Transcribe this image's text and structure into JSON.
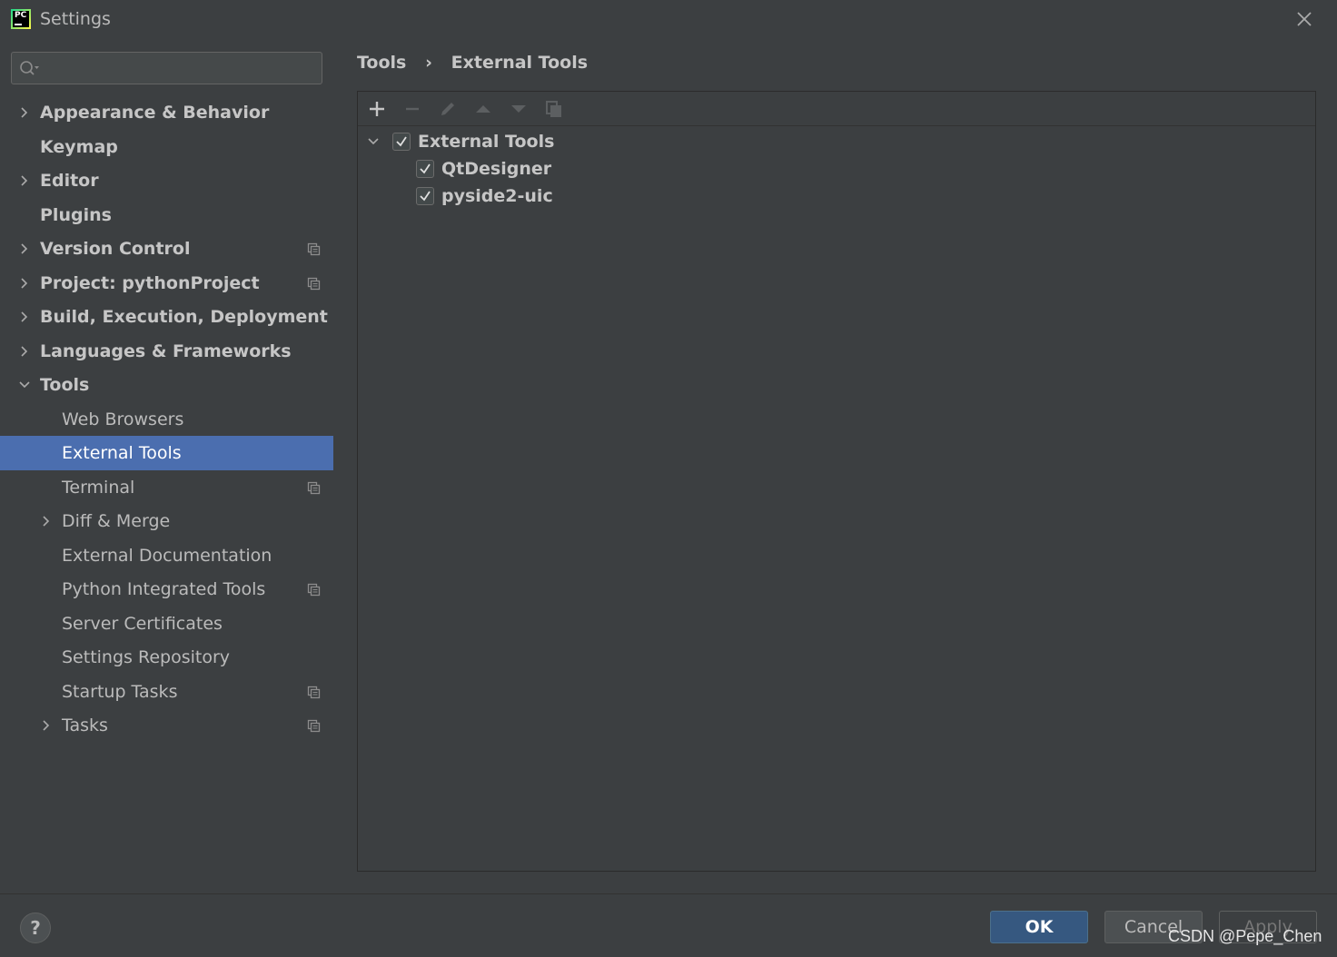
{
  "window": {
    "title": "Settings",
    "logo_text": "PC"
  },
  "search": {
    "value": "",
    "placeholder": ""
  },
  "sidebar": {
    "items": [
      {
        "label": "Appearance & Behavior",
        "expandable": true,
        "expanded": false,
        "bold": true,
        "project_icon": false
      },
      {
        "label": "Keymap",
        "expandable": false,
        "bold": true,
        "project_icon": false
      },
      {
        "label": "Editor",
        "expandable": true,
        "expanded": false,
        "bold": true,
        "project_icon": false
      },
      {
        "label": "Plugins",
        "expandable": false,
        "bold": true,
        "project_icon": false
      },
      {
        "label": "Version Control",
        "expandable": true,
        "expanded": false,
        "bold": true,
        "project_icon": true
      },
      {
        "label": "Project: pythonProject",
        "expandable": true,
        "expanded": false,
        "bold": true,
        "project_icon": true
      },
      {
        "label": "Build, Execution, Deployment",
        "expandable": true,
        "expanded": false,
        "bold": true,
        "project_icon": false
      },
      {
        "label": "Languages & Frameworks",
        "expandable": true,
        "expanded": false,
        "bold": true,
        "project_icon": false
      },
      {
        "label": "Tools",
        "expandable": true,
        "expanded": true,
        "bold": true,
        "project_icon": false
      },
      {
        "label": "Web Browsers",
        "expandable": false,
        "bold": false,
        "project_icon": false
      },
      {
        "label": "External Tools",
        "expandable": false,
        "bold": false,
        "selected": true,
        "project_icon": false
      },
      {
        "label": "Terminal",
        "expandable": false,
        "bold": false,
        "project_icon": true
      },
      {
        "label": "Diff & Merge",
        "expandable": true,
        "expanded": false,
        "bold": false,
        "project_icon": false
      },
      {
        "label": "External Documentation",
        "expandable": false,
        "bold": false,
        "project_icon": false
      },
      {
        "label": "Python Integrated Tools",
        "expandable": false,
        "bold": false,
        "project_icon": true
      },
      {
        "label": "Server Certificates",
        "expandable": false,
        "bold": false,
        "project_icon": false
      },
      {
        "label": "Settings Repository",
        "expandable": false,
        "bold": false,
        "project_icon": false
      },
      {
        "label": "Startup Tasks",
        "expandable": false,
        "bold": false,
        "project_icon": true
      },
      {
        "label": "Tasks",
        "expandable": true,
        "expanded": false,
        "bold": false,
        "project_icon": true
      }
    ]
  },
  "breadcrumb": {
    "parent": "Tools",
    "separator": "›",
    "current": "External Tools"
  },
  "toolbar": {
    "buttons": [
      "add-icon",
      "remove-icon",
      "edit-icon",
      "move-up-icon",
      "move-down-icon",
      "copy-icon"
    ]
  },
  "tools_tree": {
    "group": {
      "label": "External Tools",
      "checked": true,
      "expanded": true
    },
    "tools": [
      {
        "label": "QtDesigner",
        "checked": true
      },
      {
        "label": "pyside2-uic",
        "checked": true
      }
    ]
  },
  "footer": {
    "help_label": "?",
    "ok_label": "OK",
    "cancel_label": "Cancel",
    "apply_label": "Apply"
  },
  "watermark": "CSDN @Pepe_Chen",
  "colors": {
    "background": "#3c3f41",
    "selection": "#4b6eaf",
    "ok_button": "#365880"
  }
}
